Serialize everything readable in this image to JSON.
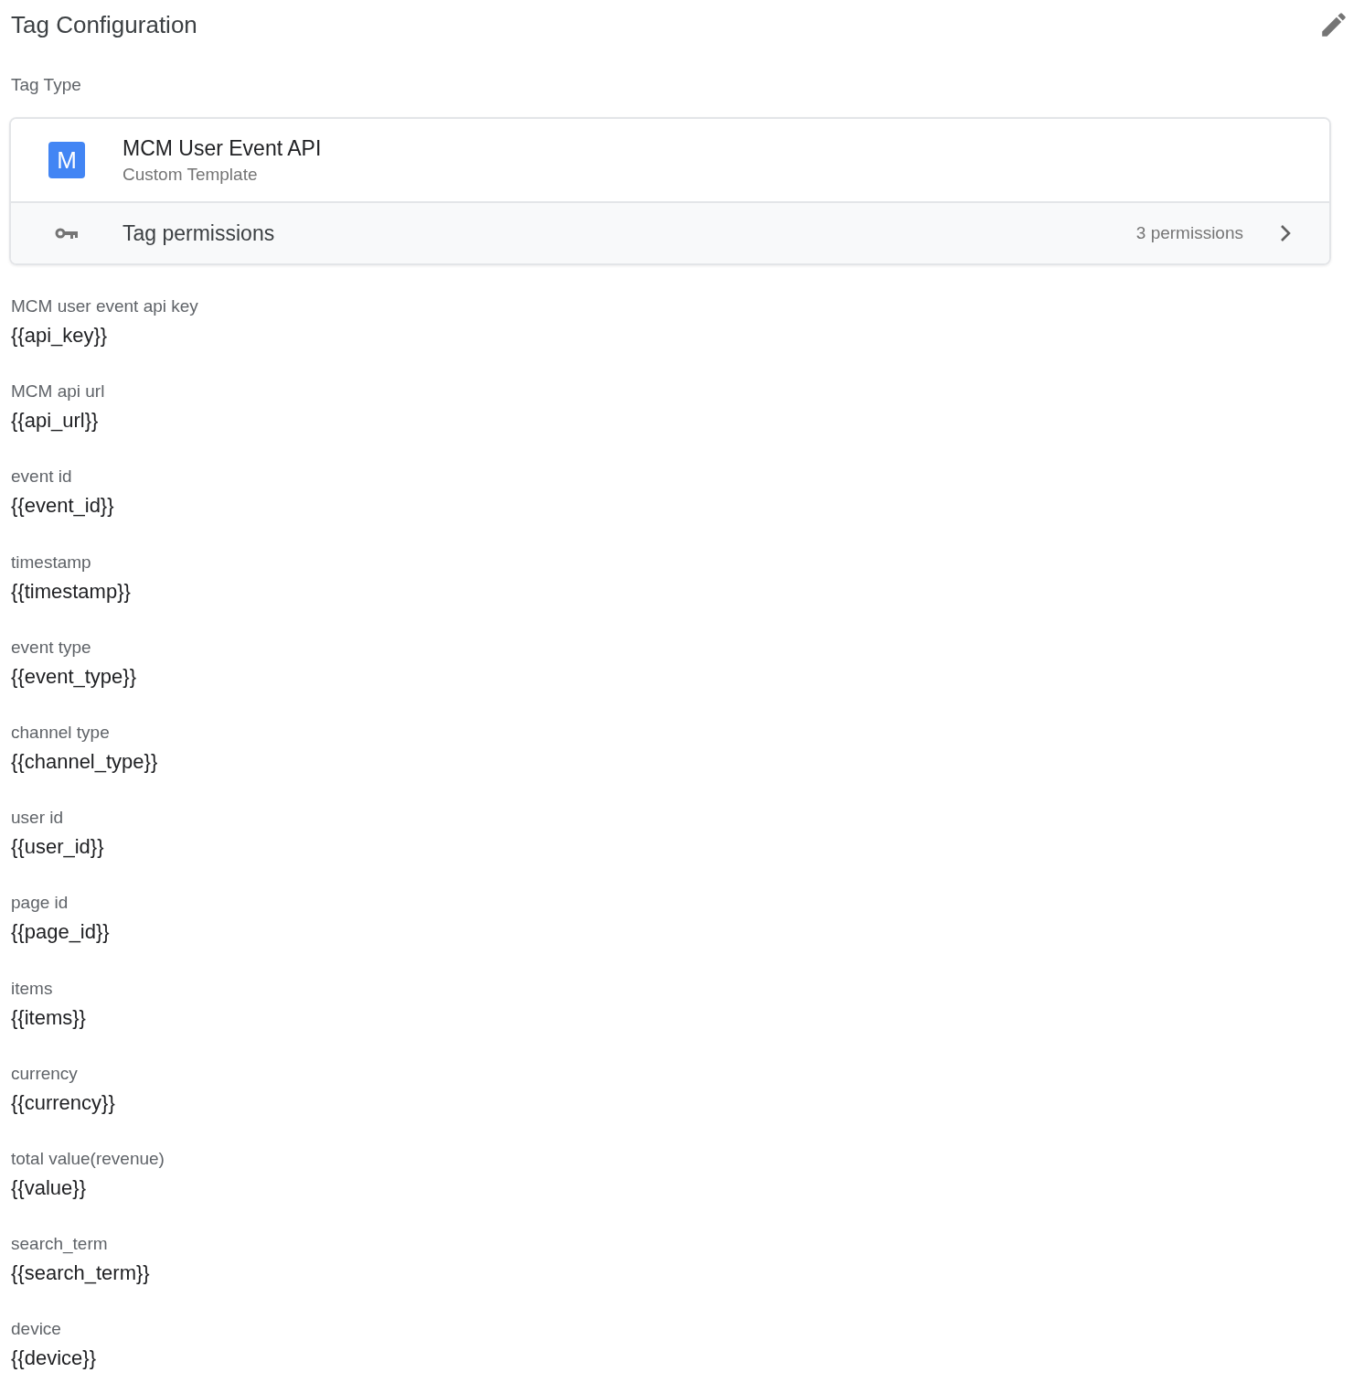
{
  "title": "Tag Configuration",
  "tag_type": {
    "label": "Tag Type",
    "icon_letter": "M",
    "name": "MCM User Event API",
    "subtitle": "Custom Template",
    "permissions_label": "Tag permissions",
    "permissions_count": "3 permissions"
  },
  "fields": [
    {
      "label": "MCM user event api key",
      "value": "{{api_key}}"
    },
    {
      "label": "MCM api url",
      "value": "{{api_url}}"
    },
    {
      "label": "event id",
      "value": "{{event_id}}"
    },
    {
      "label": "timestamp",
      "value": "{{timestamp}}"
    },
    {
      "label": "event type",
      "value": "{{event_type}}"
    },
    {
      "label": "channel type",
      "value": "{{channel_type}}"
    },
    {
      "label": "user id",
      "value": "{{user_id}}"
    },
    {
      "label": "page id",
      "value": "{{page_id}}"
    },
    {
      "label": "items",
      "value": "{{items}}"
    },
    {
      "label": "currency",
      "value": "{{currency}}"
    },
    {
      "label": "total value(revenue)",
      "value": "{{value}}"
    },
    {
      "label": "search_term",
      "value": "{{search_term}}"
    },
    {
      "label": "device",
      "value": "{{device}}"
    }
  ]
}
